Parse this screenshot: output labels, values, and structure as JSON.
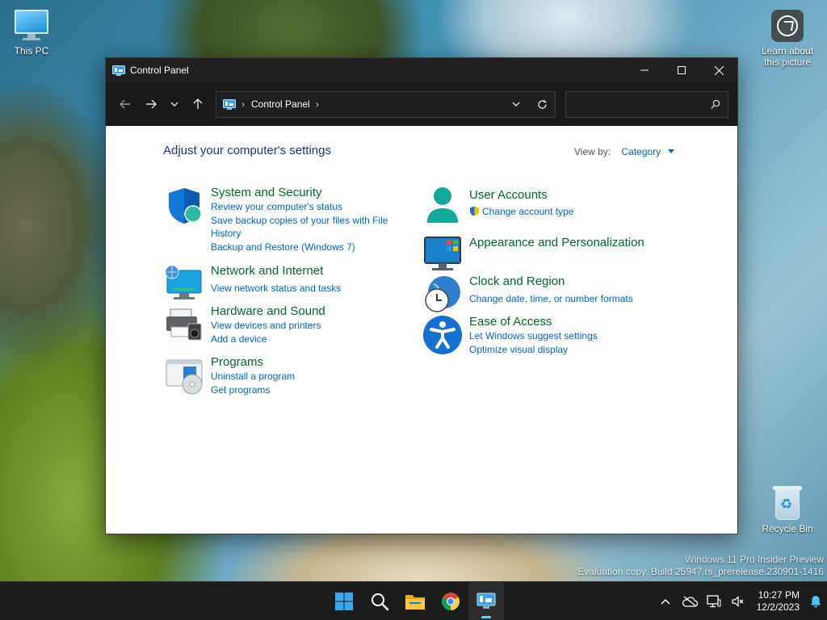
{
  "desktop": {
    "icons": {
      "this_pc": "This PC",
      "learn": "Learn about this picture",
      "recycle_bin": "Recycle Bin"
    },
    "watermark": {
      "line1": "Windows 11 Pro Insider Preview",
      "line2": "Evaluation copy. Build 25947.rs_prerelease.230901-1416"
    }
  },
  "window": {
    "title": "Control Panel",
    "controls": {
      "minimize": "─",
      "maximize": "☐",
      "close": "✕"
    }
  },
  "navbar": {
    "back": "←",
    "forward": "→",
    "recent": "⌄",
    "up": "↑",
    "breadcrumb": "Control Panel",
    "sep": "›",
    "search_value": "",
    "search_placeholder": ""
  },
  "content": {
    "heading": "Adjust your computer's settings",
    "view_by_label": "View by:",
    "view_by_value": "Category",
    "left": [
      {
        "title": "System and Security",
        "links": [
          "Review your computer's status",
          "Save backup copies of your files with File History",
          "Backup and Restore (Windows 7)"
        ]
      },
      {
        "title": "Network and Internet",
        "links": [
          "View network status and tasks"
        ]
      },
      {
        "title": "Hardware and Sound",
        "links": [
          "View devices and printers",
          "Add a device"
        ]
      },
      {
        "title": "Programs",
        "links": [
          "Uninstall a program",
          "Get programs"
        ]
      }
    ],
    "right": [
      {
        "title": "User Accounts",
        "links": [
          "Change account type"
        ]
      },
      {
        "title": "Appearance and Personalization",
        "links": []
      },
      {
        "title": "Clock and Region",
        "links": [
          "Change date, time, or number formats"
        ]
      },
      {
        "title": "Ease of Access",
        "links": [
          "Let Windows suggest settings",
          "Optimize visual display"
        ]
      }
    ]
  },
  "taskbar": {
    "apps": [
      "start-icon",
      "search-icon",
      "file-explorer-icon",
      "chrome-icon",
      "control-panel-icon"
    ],
    "time": "10:27 PM",
    "date": "12/2/2023"
  },
  "colors": {
    "link": "#0066cc",
    "category_title": "#006a27",
    "heading": "#1e3287",
    "accent": "#60cdff"
  }
}
